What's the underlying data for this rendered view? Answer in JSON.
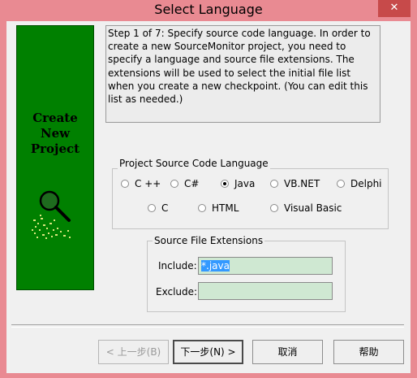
{
  "window": {
    "title": "Select Language",
    "close_glyph": "✕"
  },
  "banner": {
    "line1": "Create",
    "line2": "New",
    "line3": "Project",
    "icon": "magnifier-icon",
    "background_color": "#008000"
  },
  "description": {
    "text": "Step 1 of 7: Specify source code language. In order to create a new SourceMonitor project, you need to specify a language and source file extensions. The extensions will be used to select the initial file list when you create a new checkpoint. (You can edit this list as needed.)"
  },
  "language_group": {
    "label": "Project Source Code Language",
    "options": [
      {
        "label": "C ++",
        "checked": false
      },
      {
        "label": "C#",
        "checked": false
      },
      {
        "label": "Java",
        "checked": true
      },
      {
        "label": "VB.NET",
        "checked": false
      },
      {
        "label": "Delphi",
        "checked": false
      },
      {
        "label": "C",
        "checked": false
      },
      {
        "label": "HTML",
        "checked": false
      },
      {
        "label": "Visual Basic",
        "checked": false
      }
    ]
  },
  "extensions_group": {
    "label": "Source File Extensions",
    "include_label": "Include:",
    "include_value": "*.java",
    "exclude_label": "Exclude:",
    "exclude_value": "",
    "field_color": "#cfe8d2"
  },
  "buttons": {
    "back": "< 上一步(B)",
    "next": "下一步(N) >",
    "cancel": "取消",
    "help": "帮助"
  }
}
